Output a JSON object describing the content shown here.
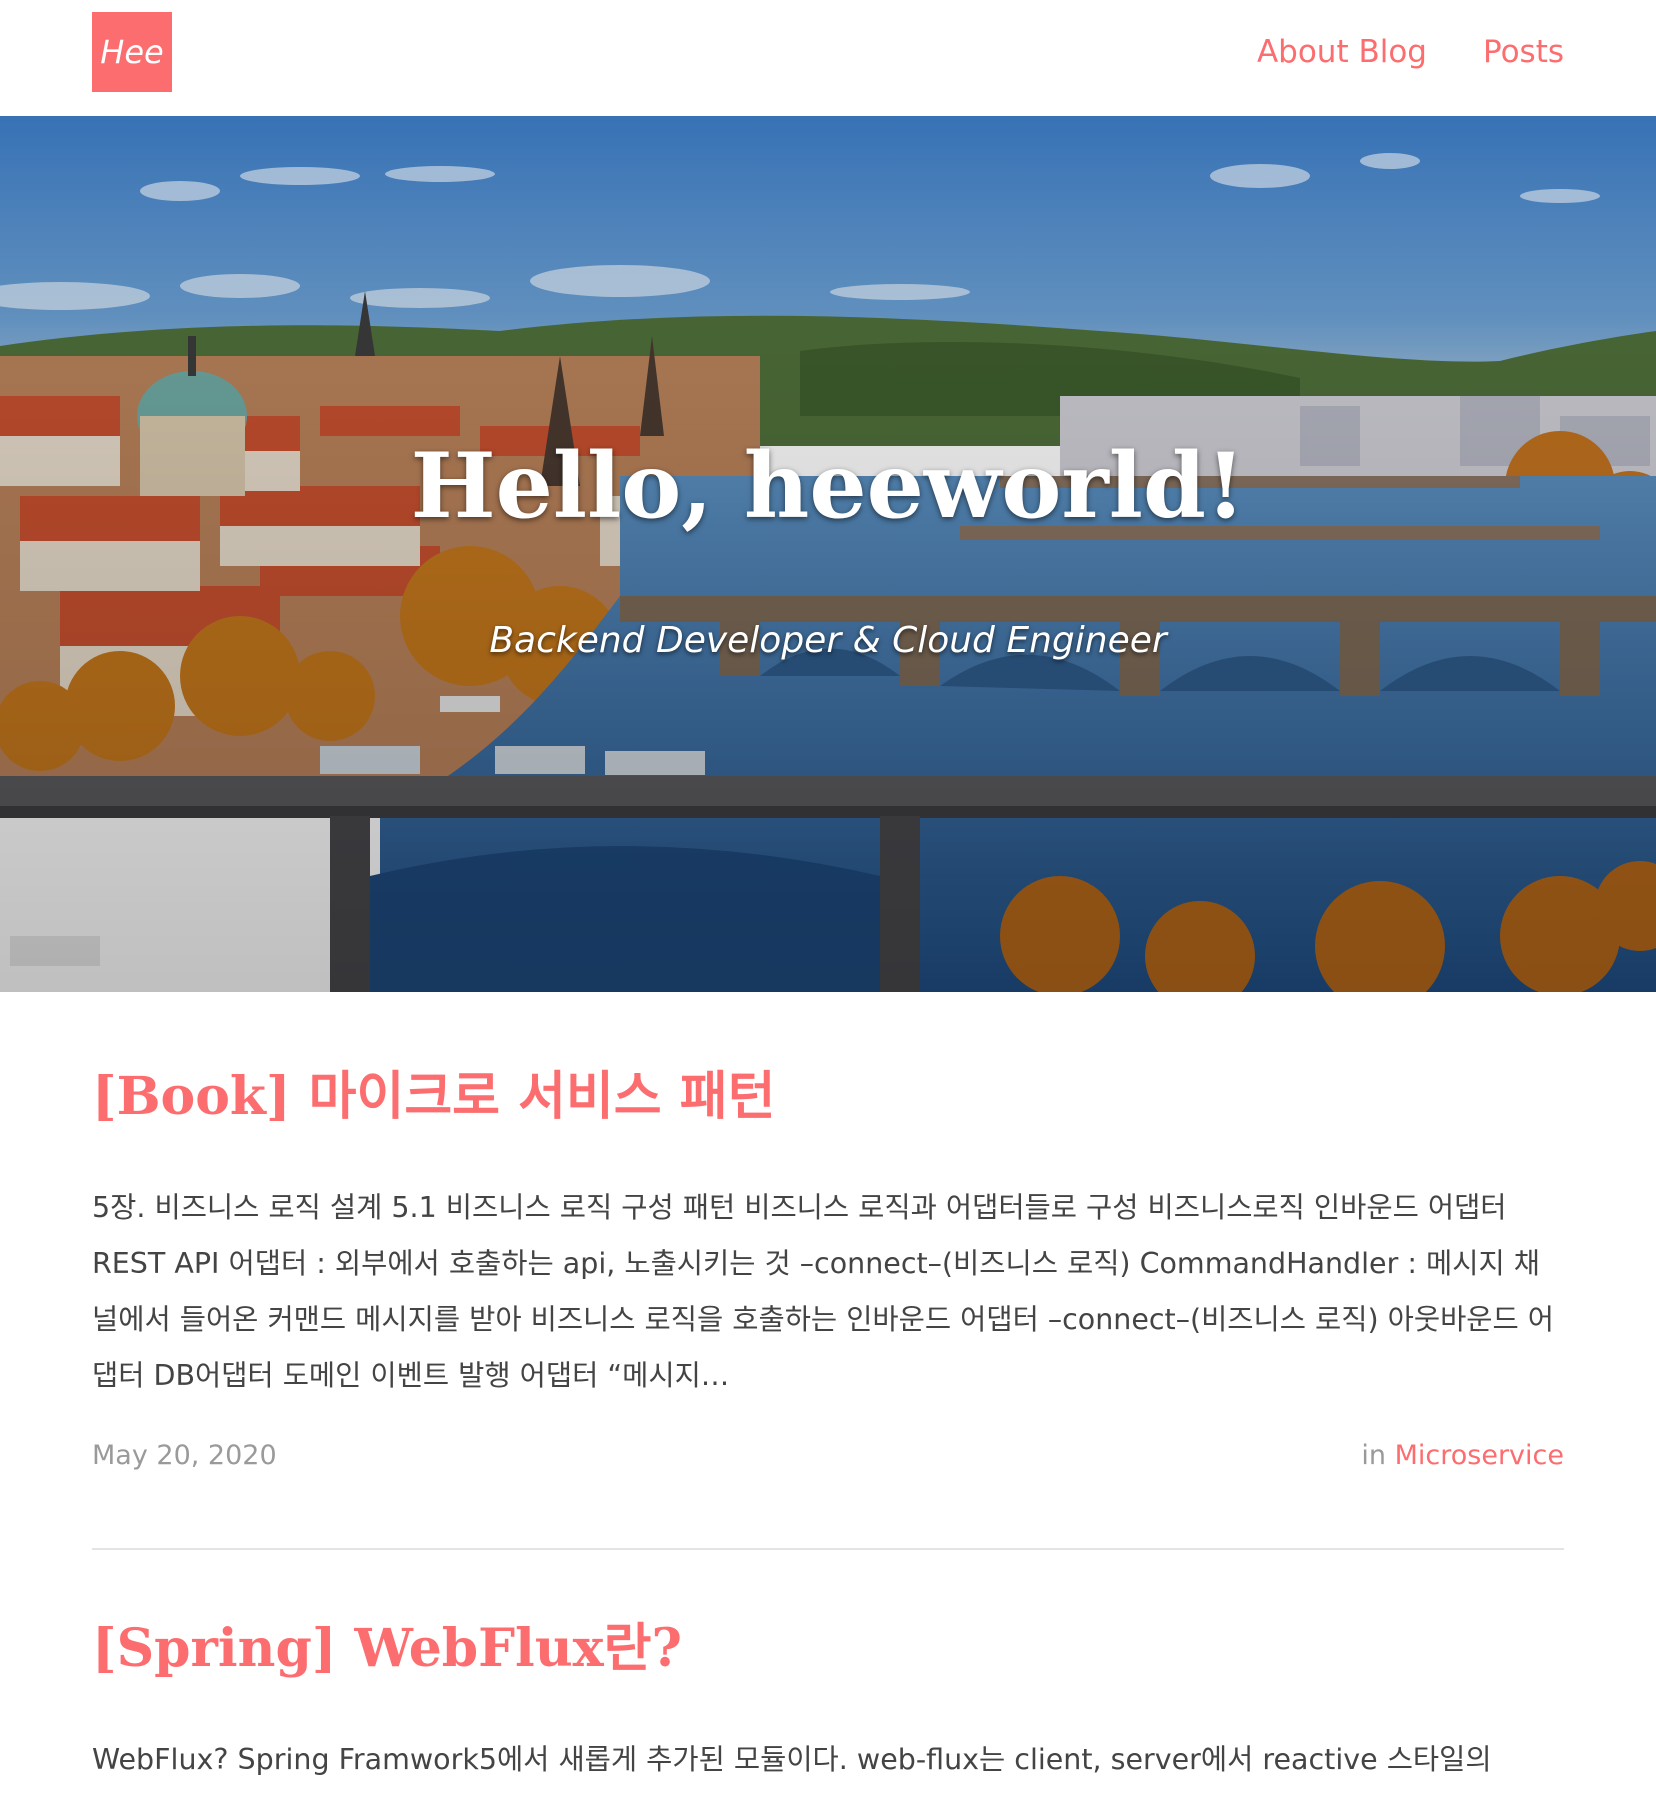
{
  "header": {
    "logo_text": "Hee",
    "nav": [
      {
        "label": "About Blog"
      },
      {
        "label": "Posts"
      }
    ]
  },
  "hero": {
    "title": "Hello, heeworld!",
    "subtitle": "Backend Developer & Cloud Engineer",
    "image_icon": "city-river-bridges-photo"
  },
  "posts": [
    {
      "title": "[Book] 마이크로 서비스 패턴",
      "excerpt": "5장. 비즈니스 로직 설계 5.1 비즈니스 로직 구성 패턴 비즈니스 로직과 어댑터들로 구성 비즈니스로직 인바운드 어댑터 REST API 어댑터 : 외부에서 호출하는 api, 노출시키는 것 –connect–(비즈니스 로직) CommandHandler : 메시지 채널에서 들어온 커맨드 메시지를 받아 비즈니스 로직을 호출하는 인바운드 어댑터 –connect–(비즈니스 로직) 아웃바운드 어댑터 DB어댑터 도메인 이벤트 발행 어댑터 “메시지…",
      "date": "May 20, 2020",
      "category_prefix": "in",
      "category": "Microservice"
    },
    {
      "title": "[Spring] WebFlux란?",
      "excerpt": "WebFlux? Spring Framwork5에서 새롭게 추가된 모듈이다. web-flux는 client, server에서 reactive 스타일의"
    }
  ],
  "colors": {
    "accent": "#fc6d6f",
    "text": "#444444",
    "muted": "#9a9a9a"
  }
}
